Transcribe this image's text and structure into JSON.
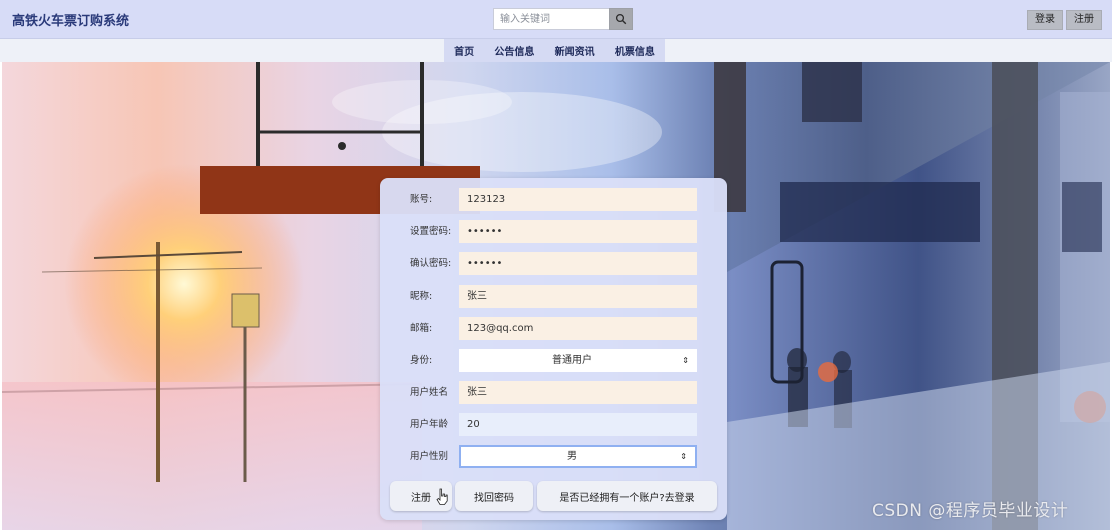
{
  "header": {
    "title": "高铁火车票订购系统",
    "search_placeholder": "输入关键词",
    "search_icon": "search-icon",
    "login_label": "登录",
    "register_label": "注册"
  },
  "nav": {
    "items": [
      {
        "label": "首页"
      },
      {
        "label": "公告信息"
      },
      {
        "label": "新闻资讯"
      },
      {
        "label": "机票信息"
      }
    ]
  },
  "form": {
    "fields": [
      {
        "label": "账号:",
        "value": "123123"
      },
      {
        "label": "设置密码:",
        "value": "••••••"
      },
      {
        "label": "确认密码:",
        "value": "••••••"
      },
      {
        "label": "昵称:",
        "value": "张三"
      },
      {
        "label": "邮箱:",
        "value": "123@qq.com"
      },
      {
        "label": "身份:",
        "value": "普通用户"
      },
      {
        "label": "用户姓名",
        "value": "张三"
      },
      {
        "label": "用户年龄",
        "value": "20"
      },
      {
        "label": "用户性别",
        "value": "男"
      }
    ],
    "buttons": {
      "register": "注册",
      "find_password": "找回密码",
      "goto_login": "是否已经拥有一个账户?去登录"
    }
  },
  "watermark": "CSDN @程序员毕业设计",
  "colors": {
    "header_bg": "#d7dcf7",
    "nav_bg": "#d5daf3",
    "form_bg": "#dadff8",
    "field_bg": "#faf0e4"
  }
}
